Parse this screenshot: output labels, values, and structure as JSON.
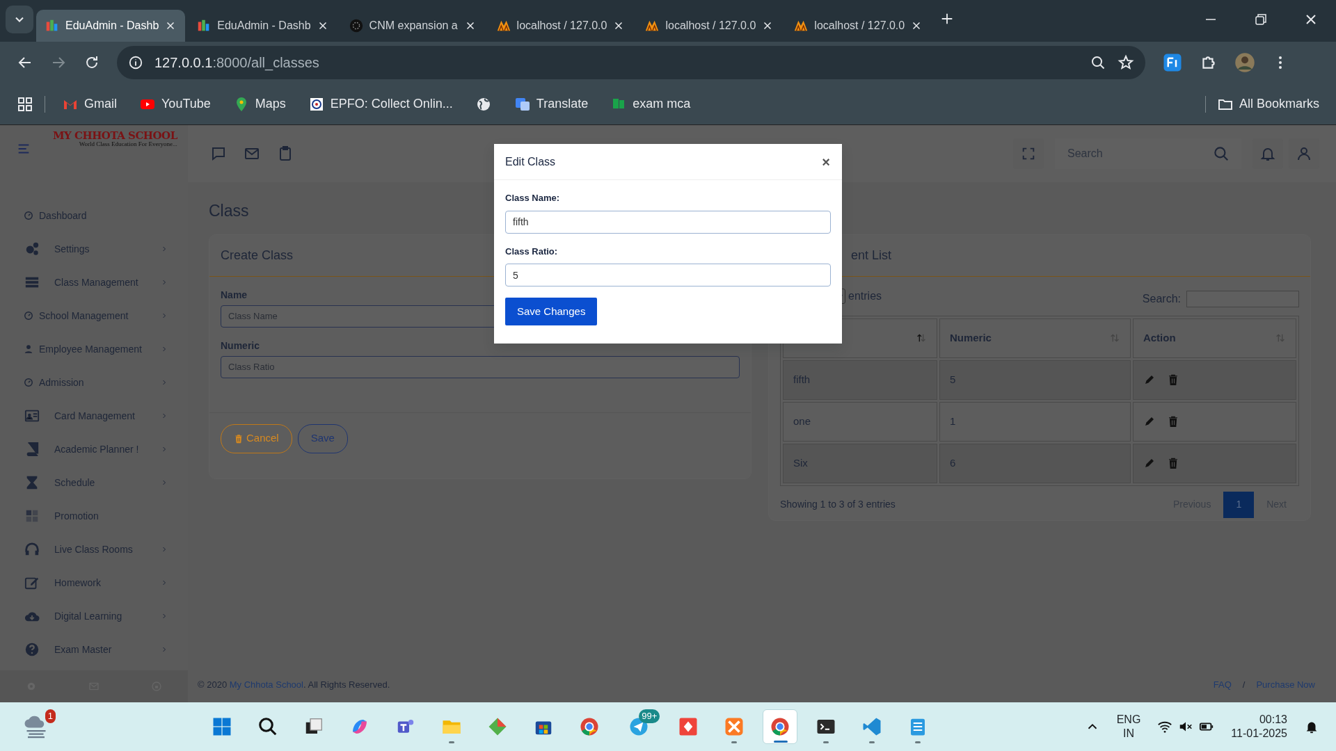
{
  "browser": {
    "tabs": [
      {
        "title": "EduAdmin - Dashb",
        "selected": true
      },
      {
        "title": "EduAdmin - Dashb",
        "selected": false
      },
      {
        "title": "CNM expansion a",
        "selected": false
      },
      {
        "title": "localhost / 127.0.0",
        "selected": false
      },
      {
        "title": "localhost / 127.0.0",
        "selected": false
      },
      {
        "title": "localhost / 127.0.0",
        "selected": false
      }
    ],
    "address": {
      "host": "127.0.0.1",
      "path": ":8000/all_classes"
    },
    "bookmarks": [
      {
        "kind": "link",
        "label": "Gmail"
      },
      {
        "kind": "link",
        "label": "YouTube"
      },
      {
        "kind": "link",
        "label": "Maps"
      },
      {
        "kind": "link",
        "label": "EPFO: Collect Onlin..."
      },
      {
        "kind": "icon"
      },
      {
        "kind": "link",
        "label": "Translate"
      },
      {
        "kind": "link",
        "label": "exam mca"
      }
    ],
    "all_bookmarks": "All Bookmarks"
  },
  "sidebar": {
    "logo": {
      "title": "MY CHHOTA SCHOOL",
      "tagline": "World Class Education For Everyone..."
    },
    "items": [
      {
        "label": "Dashboard",
        "has_submenu": false
      },
      {
        "label": "Settings",
        "has_submenu": true
      },
      {
        "label": "Class Management",
        "has_submenu": true
      },
      {
        "label": "School Management",
        "has_submenu": true
      },
      {
        "label": "Employee Management",
        "has_submenu": true
      },
      {
        "label": "Admission",
        "has_submenu": true
      },
      {
        "label": "Card Management",
        "has_submenu": true
      },
      {
        "label": "Academic Planner !",
        "has_submenu": true
      },
      {
        "label": "Schedule",
        "has_submenu": true
      },
      {
        "label": "Promotion",
        "has_submenu": false
      },
      {
        "label": "Live Class Rooms",
        "has_submenu": true
      },
      {
        "label": "Homework",
        "has_submenu": true
      },
      {
        "label": "Digital Learning",
        "has_submenu": true
      },
      {
        "label": "Exam Master",
        "has_submenu": true
      }
    ]
  },
  "header": {
    "search": {
      "placeholder": "Search"
    }
  },
  "page": {
    "title": "Class",
    "create_card": {
      "title": "Create Class",
      "fields": [
        {
          "label": "Name",
          "placeholder": "Class Name"
        },
        {
          "label": "Numeric",
          "placeholder": "Class Ratio"
        }
      ],
      "cancel": "Cancel",
      "save": "Save"
    },
    "list_card": {
      "title": "ent List",
      "length_suffix": "entries",
      "search_label": "Search:",
      "columns": [
        {
          "sorted": true
        },
        {
          "label": "Numeric",
          "sorted": false
        },
        {
          "label": "Action",
          "sorted": false
        }
      ],
      "rows": [
        {
          "name": "fifth",
          "numeric": "5"
        },
        {
          "name": "one",
          "numeric": "1"
        },
        {
          "name": "Six",
          "numeric": "6"
        }
      ],
      "info": "Showing 1 to 3 of 3 entries",
      "pagination": {
        "previous": {
          "label": "Previous",
          "disabled": true
        },
        "pages": [
          {
            "label": "1",
            "selected": true
          }
        ],
        "next": {
          "label": "Next",
          "disabled": true
        }
      }
    }
  },
  "footer": {
    "copyright": {
      "prefix": "© 2020 ",
      "link": "My Chhota School",
      "suffix": ". All Rights Reserved."
    },
    "links": [
      "FAQ",
      "Purchase Now"
    ],
    "separator": "/"
  },
  "modal": {
    "title": "Edit Class",
    "close": "×",
    "fields": [
      {
        "label": "Class Name:",
        "value": "fifth"
      },
      {
        "label": "Class Ratio:",
        "value": "5"
      }
    ],
    "button": "Save Changes"
  },
  "taskbar": {
    "weather_badge": "1",
    "apps": [
      {
        "running": false,
        "active": false
      },
      {
        "running": false,
        "active": false
      },
      {
        "running": false,
        "active": false
      },
      {
        "running": false,
        "active": false
      },
      {
        "running": false,
        "active": false
      },
      {
        "running": true,
        "active": false
      },
      {
        "running": false,
        "active": false
      },
      {
        "running": false,
        "active": false
      },
      {
        "running": false,
        "active": false
      },
      {
        "running": false,
        "active": false,
        "badge": "99+"
      },
      {
        "running": false,
        "active": false
      },
      {
        "running": true,
        "active": false
      },
      {
        "running": true,
        "active": true
      },
      {
        "running": true,
        "active": false
      },
      {
        "running": true,
        "active": false
      },
      {
        "running": true,
        "active": false
      }
    ],
    "language": [
      "ENG",
      "IN"
    ],
    "time": "00:13",
    "date": "11-01-2025"
  }
}
